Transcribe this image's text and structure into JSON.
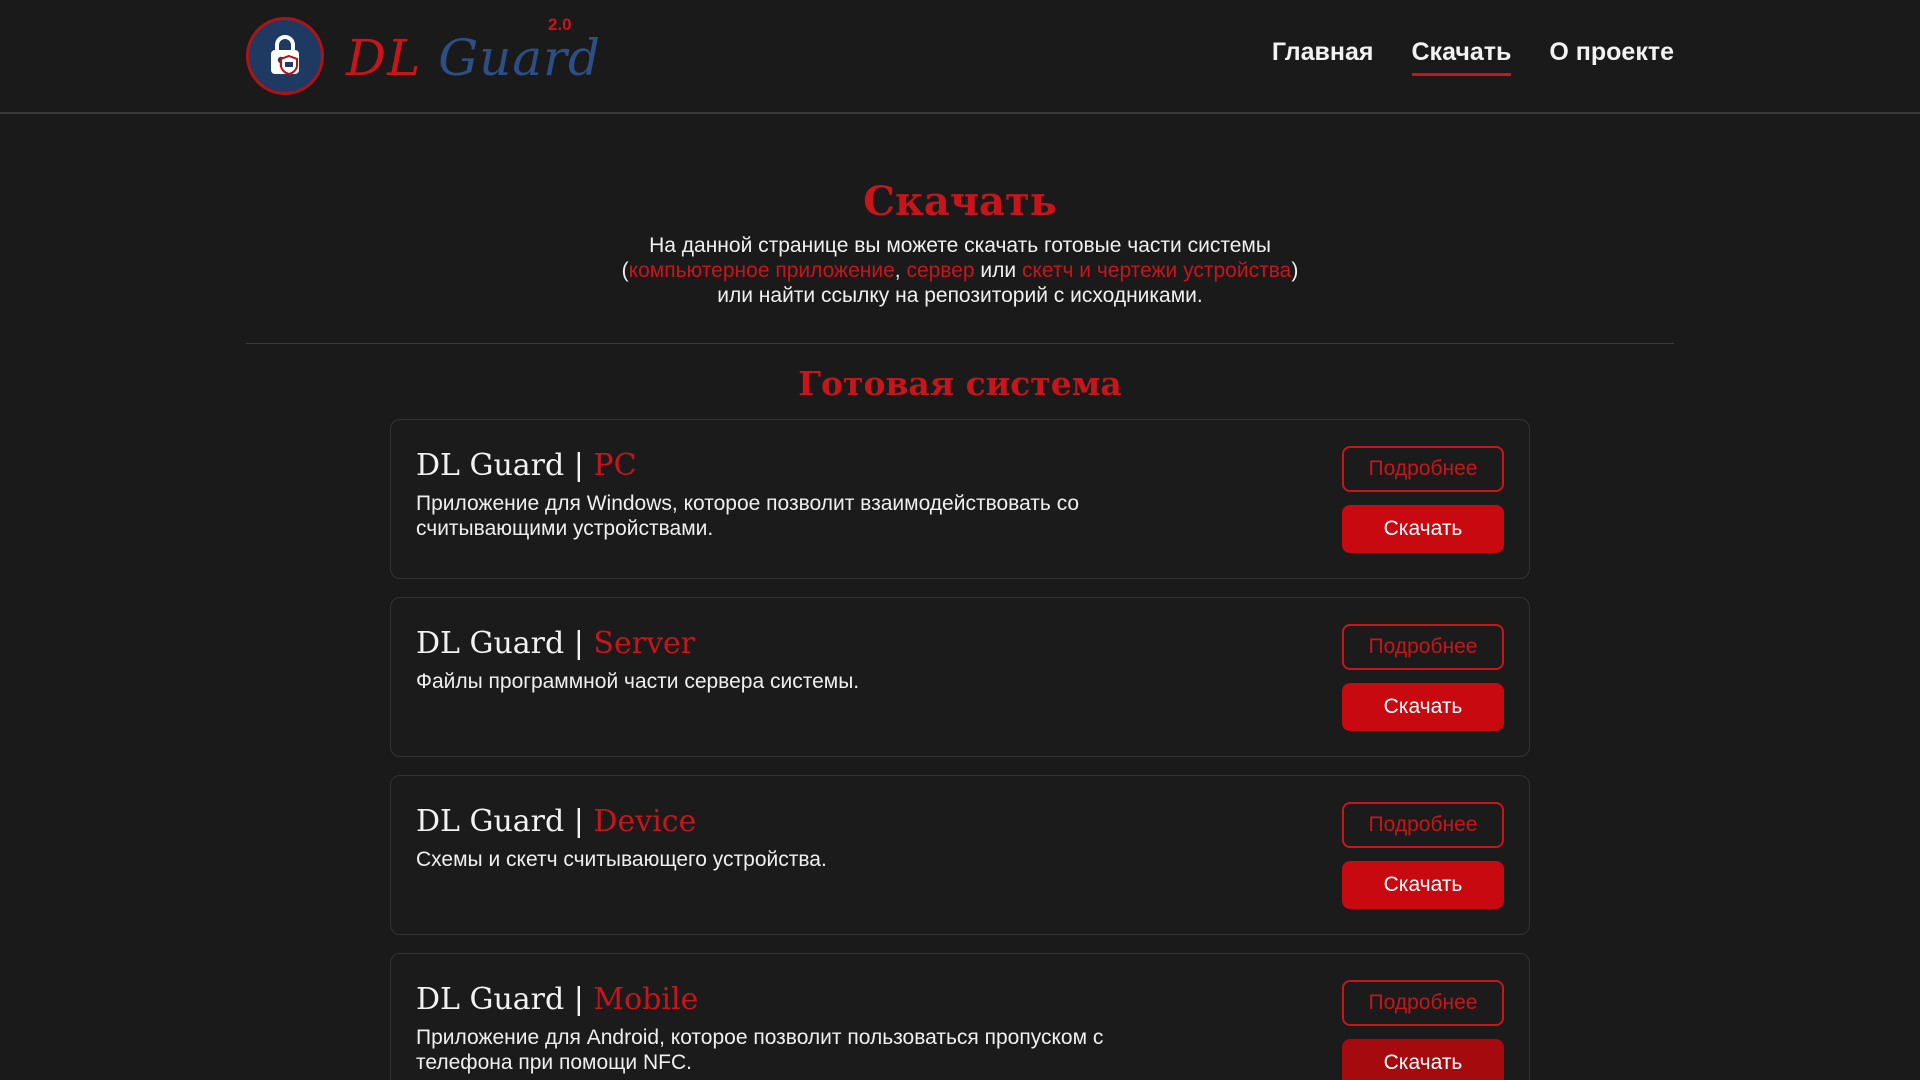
{
  "header": {
    "logo": {
      "dl": "DL",
      "guard": "Guard",
      "version": "2.0",
      "icon": "lock-shield-icon"
    },
    "nav": [
      {
        "label": "Главная",
        "active": false
      },
      {
        "label": "Скачать",
        "active": true
      },
      {
        "label": "О проекте",
        "active": false
      }
    ]
  },
  "intro": {
    "title": "Скачать",
    "line1": "На данной странице вы можете скачать готовые части системы",
    "open_paren": "(",
    "link_app": "компьютерное приложение",
    "comma": ", ",
    "link_server": "сервер",
    "or": " или ",
    "link_sketch": "скетч и чертежи устройства",
    "close_paren": ")",
    "line3": "или найти ссылку на репозиторий с исходниками."
  },
  "section": {
    "title": "Готовая система"
  },
  "cards": [
    {
      "brand": "DL Guard",
      "sep": " | ",
      "name": "PC",
      "description": "Приложение для Windows, которое позволит взаимодействовать со считывающими устройствами.",
      "details_label": "Подробнее",
      "download_label": "Скачать"
    },
    {
      "brand": "DL Guard",
      "sep": " | ",
      "name": "Server",
      "description": "Файлы программной части сервера системы.",
      "details_label": "Подробнее",
      "download_label": "Скачать"
    },
    {
      "brand": "DL Guard",
      "sep": " | ",
      "name": "Device",
      "description": "Схемы и скетч считывающего устройства.",
      "details_label": "Подробнее",
      "download_label": "Скачать"
    },
    {
      "brand": "DL Guard",
      "sep": " | ",
      "name": "Mobile",
      "description": "Приложение для Android, которое позволит пользоваться пропуском с телефона при помощи NFC.",
      "details_label": "Подробнее",
      "download_label": "Скачать"
    }
  ],
  "colors": {
    "background": "#1a1a1b",
    "accent": "#c8151b",
    "brand_blue": "#2d4f85",
    "text": "#f0f0f0"
  }
}
